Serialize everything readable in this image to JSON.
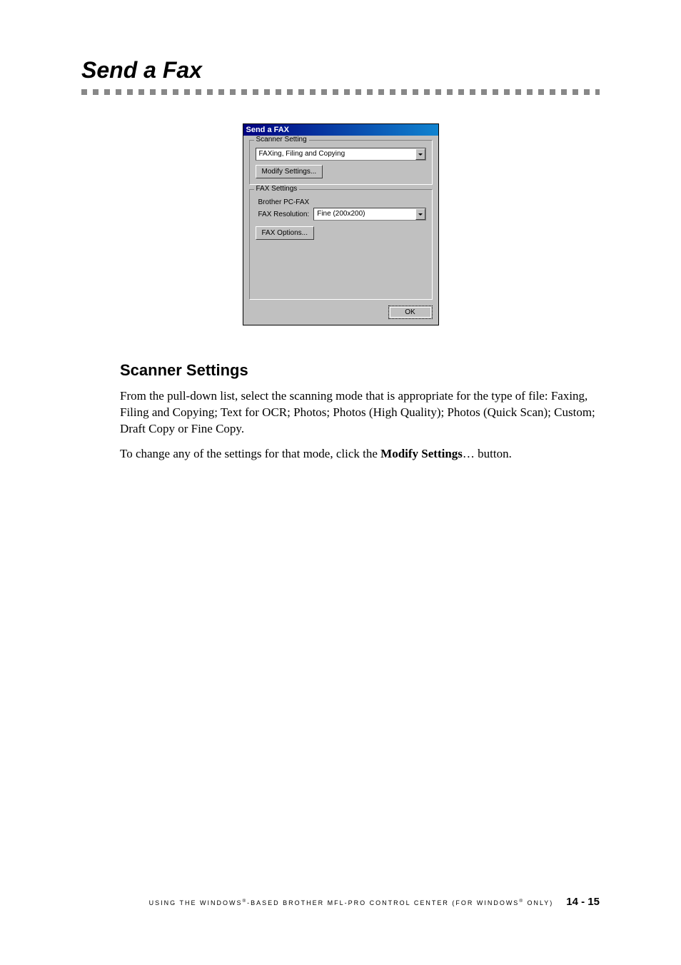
{
  "heading": "Send a Fax",
  "dialog": {
    "title": "Send a FAX",
    "scanner_group_label": "Scanner Setting",
    "scanner_mode": "FAXing, Filing and Copying",
    "modify_settings_label": "Modify Settings...",
    "fax_group_label": "FAX Settings",
    "fax_sub": "Brother PC-FAX",
    "fax_resolution_label": "FAX Resolution:",
    "fax_resolution_value": "Fine (200x200)",
    "fax_options_label": "FAX Options...",
    "ok_label": "OK"
  },
  "section_heading": "Scanner Settings",
  "paragraph1": "From the pull-down list, select the scanning mode that is appropriate for the type of file:  Faxing, Filing and Copying; Text for OCR; Photos; Photos (High Quality); Photos (Quick Scan); Custom; Draft Copy or Fine Copy.",
  "paragraph2_pre": "To change any of the settings for that mode, click the ",
  "paragraph2_bold": "Modify Settings",
  "paragraph2_post": "… button.",
  "footer": {
    "text_pre": "USING THE WINDOWS",
    "reg1": "®",
    "text_mid": "-BASED BROTHER MFL-PRO CONTROL CENTER (FOR WINDOWS",
    "reg2": "®",
    "text_post": " ONLY)",
    "page": "14 - 15"
  }
}
